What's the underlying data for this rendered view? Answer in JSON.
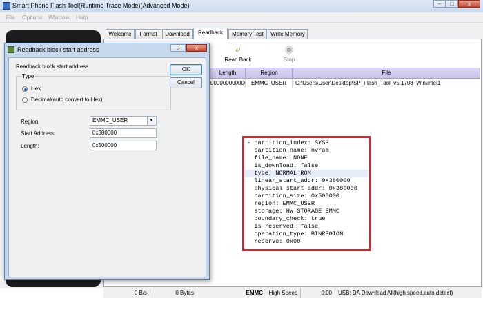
{
  "window": {
    "title": "Smart Phone Flash Tool(Runtime Trace Mode)(Advanced Mode)",
    "controls": {
      "minimize": "–",
      "maximize": "□",
      "close": "x"
    }
  },
  "menu": [
    "File",
    "Options",
    "Window",
    "Help"
  ],
  "tabs": [
    "Welcome",
    "Format",
    "Download",
    "Readback",
    "Memory Test",
    "Write Memory"
  ],
  "active_tab": "Readback",
  "toolbar": {
    "readback_label": "Read Back",
    "stop_label": "Stop"
  },
  "grid": {
    "columns": [
      "Length",
      "Region",
      "File"
    ],
    "row": {
      "length": "000000000000...",
      "region": "EMMC_USER",
      "file": "C:\\Users\\User\\Desktop\\SP_Flash_Tool_v5.1708_Win\\imei1"
    }
  },
  "partition_info": [
    "- partition_index: SYS3",
    "  partition_name: nvram",
    "  file_name: NONE",
    "  is_download: false",
    "  type: NORMAL_ROM",
    "  linear_start_addr: 0x380000",
    "  physical_start_addr: 0x380000",
    "  partition_size: 0x500000",
    "  region: EMMC_USER",
    "  storage: HW_STORAGE_EMMC",
    "  boundary_check: true",
    "  is_reserved: false",
    "  operation_type: BINREGION",
    "  reserve: 0x00"
  ],
  "highlight_line": 4,
  "status": {
    "speed": "0 B/s",
    "bytes": "0 Bytes",
    "storage": "EMMC",
    "mode": "High Speed",
    "time": "0:00",
    "usb": "USB: DA Download All(high speed,auto detect)"
  },
  "dialog": {
    "title": "Readback block start address",
    "help_btn": "?",
    "close_btn": "x",
    "heading": "Readback block start address",
    "type_label": "Type",
    "radio_hex": "Hex",
    "radio_decimal": "Decimal(auto convert to Hex)",
    "region_label": "Region",
    "region_value": "EMMC_USER",
    "start_label": "Start Address:",
    "start_value": "0x380000",
    "length_label": "Length:",
    "length_value": "0x500000",
    "ok": "OK",
    "cancel": "Cancel"
  },
  "colors": {
    "highlight_box": "#e0202a",
    "grid_header": "#c9c2ec",
    "tool_green": "#3b9a2a"
  }
}
